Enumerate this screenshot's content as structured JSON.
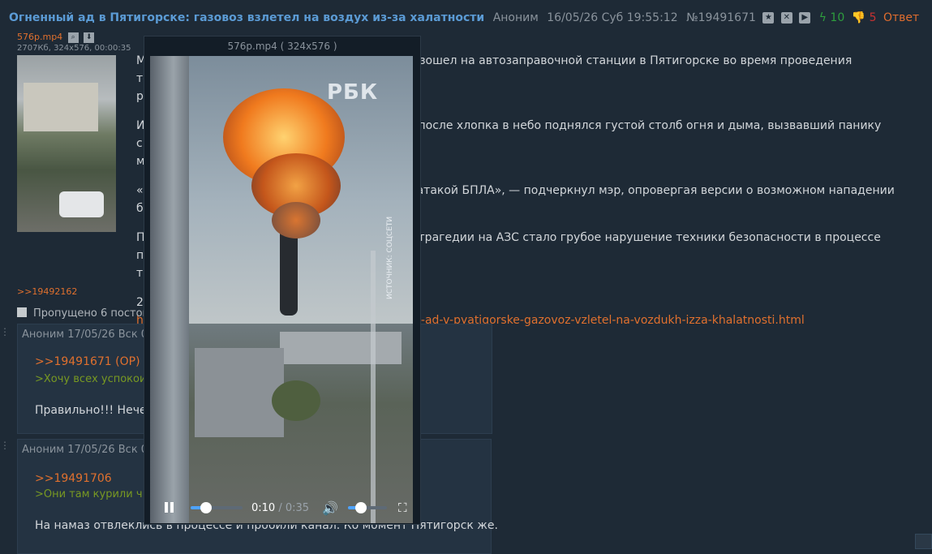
{
  "thread": {
    "title": "Огненный ад в Пятигорске: газовоз взлетел на воздух из-за халатности",
    "author": "Аноним",
    "datetime": "16/05/26 Суб 19:55:12",
    "post_number": "№19491671",
    "likes": "10",
    "dislikes": "5",
    "reply_label": "Ответ"
  },
  "file": {
    "name": "576p.mp4",
    "info": "2707Кб, 324x576, 00:00:35"
  },
  "op_text": [
    "М… [partially hidden] …зошел на автозаправочной станции в Пятигорске во время проведения технических р…",
    "И… …после хлопка в небо поднялся густой столб огня и дыма, вызвавший панику среди м…",
    "«… …атакой БПЛА», — подчеркнул мэр, опровергая версии о возможном нападении б…",
    "П… …трагедии на АЗС стало грубое нарушение техники безопасности в процессе перекачки т…"
  ],
  "op_visible": {
    "p1a": "М",
    "p1b": "зошел на автозаправочной станции в Пятигорске во время проведения технических",
    "p1c": "р",
    "p2a": "И",
    "p2b": "после хлопка в небо поднялся густой столб огня и дыма, вызвавший панику среди",
    "p2c": "м",
    "p3a": "«",
    "p3b": "атакой БПЛА», — подчеркнул мэр, опровергая версии о возможном нападении",
    "p3c": "б",
    "p4a": "П",
    "p4b": "трагедии на АЗС стало грубое нарушение техники безопасности в процессе перекачки",
    "p4c": "т",
    "p5a": "2",
    "link_a": "h",
    "link_b": "y-ad-v-pyatigorske-gazovoz-vzletel-na-vozdukh-izza-khalatnosti.html"
  },
  "backlink": ">>19492162",
  "skipped": "Пропущено 6 постов",
  "replies": [
    {
      "meta": "Аноним 17/05/26 Вск 0",
      "ref": ">>19491671 (OP)",
      "quote": ">Хочу всех успокои",
      "text": "Правильно!!! Нечег"
    },
    {
      "meta": "Аноним 17/05/26 Вск 0",
      "ref": ">>19491706",
      "quote": ">Они там курили ч",
      "text": "На намаз отвлеклись в процессе и пробили канал. Ко момент Пятигорск же."
    }
  ],
  "player": {
    "title": "576p.mp4 ( 324x576 )",
    "logo": "РБК",
    "source_label": "ИСТОЧНИК: СОЦСЕТИ",
    "current_time": "0:10",
    "separator": "/",
    "duration": "0:35",
    "progress": 0.29,
    "volume": 0.33
  },
  "colors": {
    "background": "#1e2a36",
    "title": "#5b9bd5",
    "link": "#e0702e",
    "quote": "#789922",
    "accent": "#4ea3ff"
  }
}
